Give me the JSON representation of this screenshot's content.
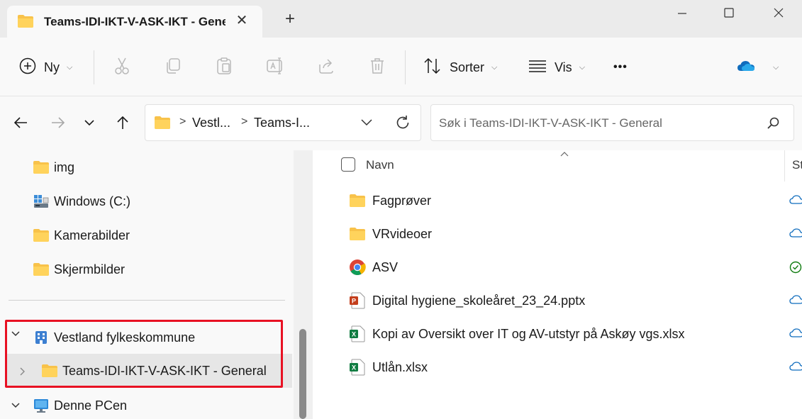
{
  "window": {
    "tab_title": "Teams-IDI-IKT-V-ASK-IKT - General",
    "tab_close": "✕",
    "new_tab": "+"
  },
  "toolbar": {
    "new_label": "Ny",
    "sort_label": "Sorter",
    "view_label": "Vis",
    "more": "•••"
  },
  "address": {
    "crumbs": [
      "Vestl...",
      "Teams-I..."
    ],
    "separator": ">"
  },
  "search": {
    "placeholder": "Søk i Teams-IDI-IKT-V-ASK-IKT - General"
  },
  "nav": {
    "items": [
      {
        "label": "img",
        "icon": "folder-icon"
      },
      {
        "label": "Windows (C:)",
        "icon": "drive-icon"
      },
      {
        "label": "Kamerabilder",
        "icon": "folder-icon"
      },
      {
        "label": "Skjermbilder",
        "icon": "folder-icon"
      },
      {
        "label": "Vestland fylkeskommune",
        "icon": "building-icon"
      },
      {
        "label": "Teams-IDI-IKT-V-ASK-IKT - General",
        "icon": "folder-icon"
      },
      {
        "label": "Denne PCen",
        "icon": "computer-icon"
      }
    ]
  },
  "content": {
    "columns": {
      "name": "Navn",
      "status": "St"
    },
    "files": [
      {
        "name": "Fagprøver",
        "icon": "folder-icon",
        "status": "cloud"
      },
      {
        "name": "VRvideoer",
        "icon": "folder-icon",
        "status": "cloud"
      },
      {
        "name": "ASV",
        "icon": "chrome-icon",
        "status": "synced"
      },
      {
        "name": "Digital hygiene_skoleåret_23_24.pptx",
        "icon": "powerpoint-icon",
        "status": "cloud"
      },
      {
        "name": "Kopi av Oversikt over IT og AV-utstyr på Askøy vgs.xlsx",
        "icon": "excel-icon",
        "status": "cloud"
      },
      {
        "name": "Utlån.xlsx",
        "icon": "excel-icon",
        "status": "cloud"
      }
    ]
  },
  "colors": {
    "folder": "#f8c24a",
    "highlight": "#e81123",
    "onedrive": "#0f6cbd",
    "excel": "#107c41",
    "powerpoint": "#c43e1c"
  }
}
